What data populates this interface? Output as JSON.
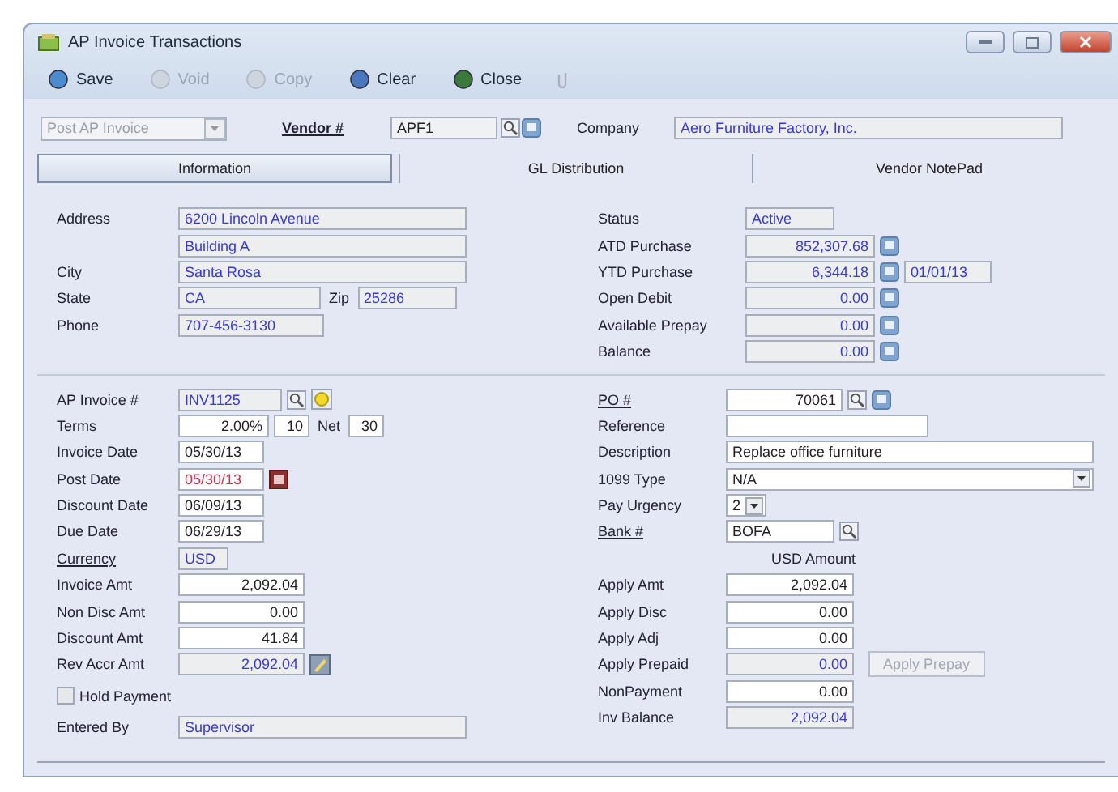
{
  "window": {
    "title": "AP Invoice Transactions"
  },
  "toolbar": [
    {
      "kind": "save",
      "label": "Save",
      "disabled": false
    },
    {
      "kind": "void",
      "label": "Void",
      "disabled": true
    },
    {
      "kind": "copy",
      "label": "Copy",
      "disabled": true
    },
    {
      "kind": "clear",
      "label": "Clear",
      "disabled": false
    },
    {
      "kind": "close",
      "label": "Close",
      "disabled": false
    },
    {
      "kind": "attach",
      "disabled": true
    }
  ],
  "header": {
    "mode": {
      "value": "Post AP Invoice",
      "disabled": true
    },
    "vendor_label": "Vendor #",
    "vendor_value": "APF1",
    "company_label": "Company",
    "company_value": "Aero Furniture Factory, Inc."
  },
  "tabs": [
    {
      "label": "Information",
      "selected": true
    },
    {
      "label": "GL Distribution",
      "selected": false
    },
    {
      "label": "Vendor NotePad",
      "selected": false
    }
  ],
  "vendor_address": [
    {
      "label": "Address",
      "controls": [
        {
          "kind": "text",
          "value": "6200 Lincoln Avenue",
          "readonly": true
        }
      ]
    },
    {
      "controls": [
        {
          "kind": "text",
          "value": "Building A",
          "readonly": true
        }
      ]
    },
    {
      "label": "City",
      "controls": [
        {
          "kind": "text",
          "value": "Santa Rosa",
          "readonly": true
        }
      ]
    },
    {
      "label": "State",
      "controls": [
        {
          "kind": "text",
          "value": "CA",
          "readonly": true
        },
        {
          "kind": "label",
          "value": "Zip"
        },
        {
          "kind": "text",
          "value": "25286",
          "readonly": true
        }
      ]
    },
    {
      "label": "Phone",
      "controls": [
        {
          "kind": "text",
          "value": "707-456-3130",
          "readonly": true
        }
      ]
    }
  ],
  "vendor_status": [
    {
      "label": "Status",
      "controls": [
        {
          "kind": "text",
          "value": "Active",
          "readonly": true
        }
      ]
    },
    {
      "label": "ATD Purchase",
      "controls": [
        {
          "kind": "amount",
          "value": "852,307.68",
          "readonly": true
        },
        {
          "kind": "note"
        }
      ]
    },
    {
      "label": "YTD Purchase",
      "controls": [
        {
          "kind": "amount",
          "value": "6,344.18",
          "readonly": true
        },
        {
          "kind": "note"
        },
        {
          "kind": "text",
          "value": "01/01/13",
          "readonly": true
        }
      ]
    },
    {
      "label": "Open Debit",
      "controls": [
        {
          "kind": "amount",
          "value": "0.00",
          "readonly": true
        },
        {
          "kind": "note"
        }
      ]
    },
    {
      "label": "Available Prepay",
      "controls": [
        {
          "kind": "amount",
          "value": "0.00",
          "readonly": true
        },
        {
          "kind": "note"
        }
      ]
    },
    {
      "label": "Balance",
      "controls": [
        {
          "kind": "amount",
          "value": "0.00",
          "readonly": true
        },
        {
          "kind": "note"
        }
      ]
    }
  ],
  "invoice": [
    {
      "kind": "fields",
      "label": "AP Invoice #",
      "link": false,
      "controls": [
        {
          "kind": "text",
          "value": "INV1125",
          "readonly": true
        },
        {
          "kind": "lookup"
        },
        {
          "kind": "new"
        }
      ]
    },
    {
      "kind": "fields",
      "label": "Terms",
      "link": false,
      "controls": [
        {
          "kind": "amount",
          "value": "2.00%",
          "readonly": false
        },
        {
          "kind": "amount",
          "value": "10",
          "readonly": false
        },
        {
          "kind": "label",
          "value": "Net"
        },
        {
          "kind": "amount",
          "value": "30",
          "readonly": false
        }
      ]
    },
    {
      "kind": "fields",
      "label": "Invoice Date",
      "link": false,
      "controls": [
        {
          "kind": "text",
          "value": "05/30/13",
          "readonly": false
        }
      ]
    },
    {
      "kind": "fields",
      "label": "Post Date",
      "link": false,
      "controls": [
        {
          "kind": "text",
          "value": "05/30/13",
          "readonly": false,
          "warning": true
        },
        {
          "kind": "calendar"
        }
      ]
    },
    {
      "kind": "fields",
      "label": "Discount Date",
      "link": false,
      "controls": [
        {
          "kind": "text",
          "value": "06/09/13",
          "readonly": false
        }
      ]
    },
    {
      "kind": "fields",
      "label": "Due Date",
      "link": false,
      "controls": [
        {
          "kind": "text",
          "value": "06/29/13",
          "readonly": false
        }
      ]
    },
    {
      "kind": "fields",
      "label": "Currency",
      "link": true,
      "controls": [
        {
          "kind": "text",
          "value": "USD",
          "readonly": true
        }
      ]
    },
    {
      "kind": "fields",
      "label": "Invoice Amt",
      "link": false,
      "controls": [
        {
          "kind": "amount",
          "value": "2,092.04",
          "readonly": false
        }
      ]
    },
    {
      "kind": "fields",
      "label": "Non Disc Amt",
      "link": false,
      "controls": [
        {
          "kind": "amount",
          "value": "0.00",
          "readonly": false
        }
      ]
    },
    {
      "kind": "fields",
      "label": "Discount Amt",
      "link": false,
      "controls": [
        {
          "kind": "amount",
          "value": "41.84",
          "readonly": false
        }
      ]
    },
    {
      "kind": "fields",
      "label": "Rev Accr Amt",
      "link": false,
      "controls": [
        {
          "kind": "amount",
          "value": "2,092.04",
          "readonly": true
        },
        {
          "kind": "edit"
        }
      ]
    },
    {
      "kind": "checkbox",
      "label": "Hold Payment",
      "checked": false
    },
    {
      "kind": "fields",
      "label": "Entered By",
      "link": false,
      "controls": [
        {
          "kind": "text",
          "value": "Supervisor",
          "readonly": true
        }
      ]
    }
  ],
  "payment": [
    {
      "kind": "fields",
      "label": "PO #",
      "link": true,
      "controls": [
        {
          "kind": "amount",
          "value": "70061",
          "readonly": false
        },
        {
          "kind": "lookup"
        },
        {
          "kind": "note"
        }
      ]
    },
    {
      "kind": "fields",
      "label": "Reference",
      "link": false,
      "controls": [
        {
          "kind": "text",
          "readonly": false
        }
      ]
    },
    {
      "kind": "fields",
      "label": "Description",
      "link": false,
      "controls": [
        {
          "kind": "text",
          "value": "Replace office furniture",
          "readonly": false
        }
      ]
    },
    {
      "kind": "fields",
      "label": "1099 Type",
      "link": false,
      "controls": [
        {
          "kind": "combo",
          "value": "N/A"
        }
      ]
    },
    {
      "kind": "fields",
      "label": "Pay Urgency",
      "link": false,
      "controls": [
        {
          "kind": "combo",
          "value": "2"
        }
      ]
    },
    {
      "kind": "fields",
      "label": "Bank #",
      "link": true,
      "controls": [
        {
          "kind": "text",
          "value": "BOFA",
          "readonly": false
        },
        {
          "kind": "lookup"
        }
      ]
    },
    {
      "kind": "heading",
      "label": "USD Amount"
    },
    {
      "kind": "fields",
      "label": "Apply Amt",
      "link": false,
      "controls": [
        {
          "kind": "amount",
          "value": "2,092.04",
          "readonly": false
        }
      ]
    },
    {
      "kind": "fields",
      "label": "Apply Disc",
      "link": false,
      "controls": [
        {
          "kind": "amount",
          "value": "0.00",
          "readonly": false
        }
      ]
    },
    {
      "kind": "fields",
      "label": "Apply Adj",
      "link": false,
      "controls": [
        {
          "kind": "amount",
          "value": "0.00",
          "readonly": false
        }
      ]
    },
    {
      "kind": "fields",
      "label": "Apply Prepaid",
      "link": false,
      "controls": [
        {
          "kind": "amount",
          "value": "0.00",
          "readonly": true
        },
        {
          "kind": "button",
          "value": "Apply Prepay",
          "disabled": true
        }
      ]
    },
    {
      "kind": "fields",
      "label": "NonPayment",
      "link": false,
      "controls": [
        {
          "kind": "amount",
          "value": "0.00",
          "readonly": false
        }
      ]
    },
    {
      "kind": "fields",
      "label": "Inv Balance",
      "link": false,
      "controls": [
        {
          "kind": "amount",
          "value": "2,092.04",
          "readonly": true
        }
      ]
    }
  ]
}
